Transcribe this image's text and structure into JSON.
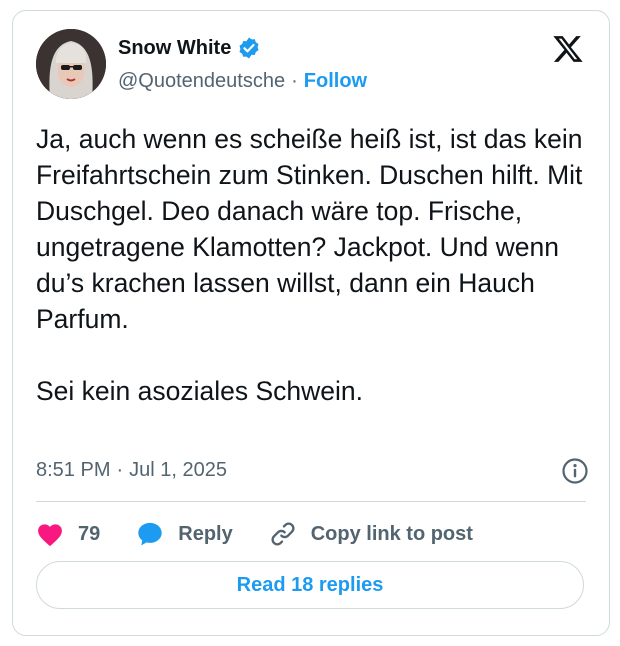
{
  "author": {
    "name": "Snow White",
    "handle": "@Quotendeutsche",
    "separator": "·",
    "follow_label": "Follow"
  },
  "tweet": {
    "text": "Ja, auch wenn es scheiße heiß ist, ist das kein Freifahrtschein zum Stinken. Duschen hilft. Mit Duschgel. Deo danach wäre top. Frische, ungetragene Klamotten? Jackpot. Und wenn du’s krachen lassen willst, dann ein Hauch Parfum.\n\nSei kein asoziales Schwein.",
    "time": "8:51 PM",
    "separator": "·",
    "date": "Jul 1, 2025"
  },
  "actions": {
    "likes": "79",
    "reply_label": "Reply",
    "copy_label": "Copy link to post"
  },
  "read_replies_label": "Read 18 replies",
  "colors": {
    "accent": "#1d9bf0",
    "like": "#f91880",
    "muted": "#536471",
    "text": "#0f1419",
    "border": "#cfd9de"
  },
  "icons": {
    "verified": "verified-badge-icon",
    "platform": "x-logo-icon",
    "info": "info-icon",
    "like": "heart-icon",
    "reply": "speech-bubble-icon",
    "copy": "link-icon"
  }
}
